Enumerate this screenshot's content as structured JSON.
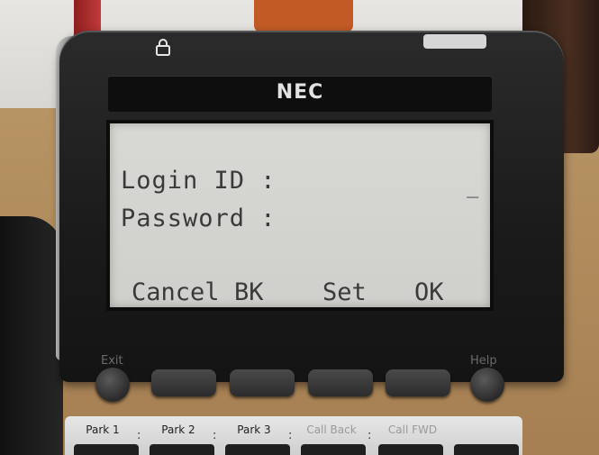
{
  "device": {
    "brand": "NEC"
  },
  "lcd": {
    "line1": "Login ID :",
    "line2": "Password :",
    "cursor": "_",
    "softkeys": [
      "Cancel",
      "BK",
      "Set",
      "OK"
    ]
  },
  "controls": {
    "exit_label": "Exit",
    "help_label": "Help"
  },
  "line_keys": [
    {
      "label": "Park 1"
    },
    {
      "label": "Park 2"
    },
    {
      "label": "Park 3"
    },
    {
      "label": "Call Back"
    },
    {
      "label": "Call FWD"
    }
  ],
  "icons": {
    "lock": "lock-icon"
  },
  "colors": {
    "lcd_background": "#d8d8d4",
    "lcd_text": "#3a3a3a",
    "phone_body": "#1a1a1a"
  }
}
